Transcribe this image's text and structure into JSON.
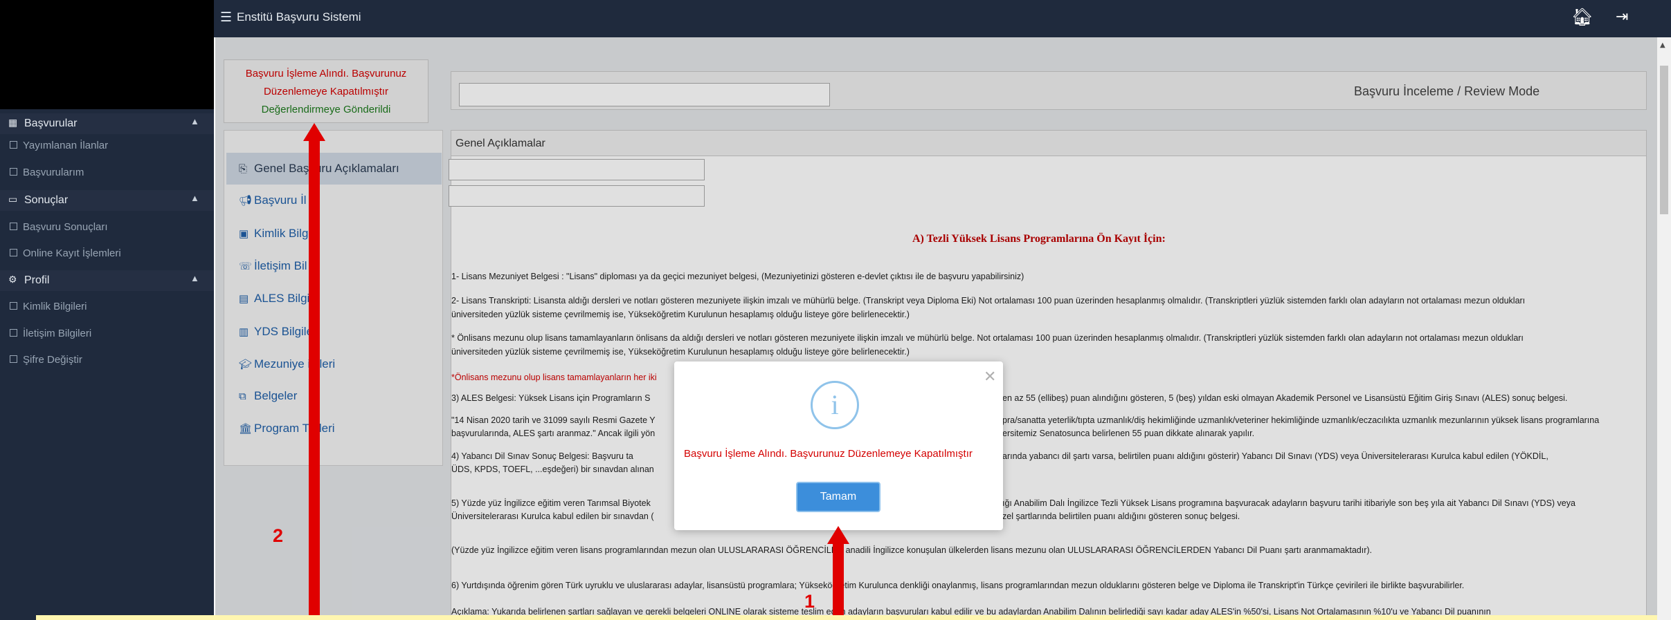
{
  "topbar": {
    "menu_icon": "hamburger-icon",
    "title": "Enstitü Başvuru Sistemi",
    "home_icon": "home-icon",
    "logout_icon": "logout-icon"
  },
  "sidebar": {
    "sections": [
      {
        "label": "Başvurular",
        "icon": "calendar-icon",
        "items": [
          "Yayımlanan İlanlar",
          "Başvurularım"
        ]
      },
      {
        "label": "Sonuçlar",
        "icon": "inbox-icon",
        "items": [
          "Başvuru Sonuçları",
          "Online Kayıt İşlemleri"
        ]
      },
      {
        "label": "Profil",
        "icon": "cogs-icon",
        "items": [
          "Kimlik Bilgileri",
          "İletişim Bilgileri",
          "Şifre Değiştir"
        ]
      }
    ]
  },
  "status": {
    "line1": "Başvuru İşleme Alındı. Başvurunuz",
    "line2": "Düzenlemeye Kapatılmıştır",
    "line3": "Değerlendirmeye Gönderildi"
  },
  "review": {
    "mode_label": "Başvuru İnceleme / Review Mode"
  },
  "left_menu": [
    {
      "label": "Genel Başvuru Açıklamaları",
      "icon": "clipboard-icon"
    },
    {
      "label": "Başvuru İl",
      "icon": "bullhorn-icon"
    },
    {
      "label": "Kimlik Bilgi",
      "icon": "id-card-icon"
    },
    {
      "label": "İletişim Bil",
      "icon": "contacts-icon"
    },
    {
      "label": "ALES Bilgil",
      "icon": "document-icon"
    },
    {
      "label": "YDS Bilgile",
      "icon": "list-icon"
    },
    {
      "label": "Mezuniye       igileri",
      "icon": "graduation-cap-icon"
    },
    {
      "label": "Belgeler",
      "icon": "copy-icon"
    },
    {
      "label": "Program T      hleri",
      "icon": "institution-icon"
    }
  ],
  "panel": {
    "title": "Genel Açıklamalar",
    "heading": "A) Tezli Yüksek Lisans Programlarına Ön Kayıt İçin:",
    "lines": [
      "1- Lisans Mezuniyet Belgesi : \"Lisans\" diploması ya da geçici mezuniyet belgesi, (Mezuniyetinizi gösteren e-devlet çıktısı ile de başvuru yapabilirsiniz)",
      "2- Lisans Transkripti:  Lisansta aldığı dersleri ve notları gösteren mezuniyete ilişkin imzalı ve mühürlü belge. (Transkript veya Diploma Eki) Not ortalaması 100 puan üzerinden hesaplanmış olmalıdır. (Transkriptleri yüzlük sistemden farklı olan adayların not ortalaması mezun oldukları",
      "üniversiteden yüzlük sisteme çevrilmemiş ise, Yükseköğretim Kurulunun hesaplamış olduğu listeye göre belirlenecektir.)",
      "* Önlisans mezunu olup lisans tamamlayanların önlisans da aldığı dersleri ve notları gösteren mezuniyete ilişkin imzalı ve mühürlü belge. Not ortalaması 100 puan üzerinden hesaplanmış olmalıdır. (Transkriptleri yüzlük sistemden farklı olan adayların not ortalaması mezun oldukları",
      "üniversiteden yüzlük sisteme çevrilmemiş ise, Yükseköğretim Kurulunun hesaplamış olduğu listeye göre belirlenecektir.)",
      "*Önlisans mezunu olup lisans tamamlayanların her iki",
      "3)  ALES Belgesi: Yüksek Lisans için Programların S",
      "en az 55 (ellibeş) puan alındığını gösteren, 5 (beş) yıldan eski olmayan Akademik Personel ve Lisansüstü Eğitim Giriş Sınavı (ALES) sonuç belgesi.",
      "\"14 Nisan 2020 tarih ve 31099 sayılı Resmi Gazete Y",
      "pra/sanatta yeterlik/tıpta uzmanlık/diş hekimliğinde uzmanlık/veteriner hekimliğinde uzmanlık/eczacılıkta uzmanlık mezunlarının yüksek lisans programlarına",
      "başvurularında, ALES şartı aranmaz.\" Ancak ilgili yön",
      "ersitemiz Senatosunca belirlenen 55 puan dikkate alınarak yapılır.",
      "4) Yabancı Dil Sınav Sonuç Belgesi: Başvuru ta",
      "arında yabancı dil şartı varsa, belirtilen puanı aldığını gösterir) Yabancı Dil Sınavı (YDS) veya Üniversitelerarası Kurulca kabul edilen (YÖKDİL,",
      "ÜDS, KPDS, TOEFL, ...eşdeğeri)  bir sınavdan alınan",
      "5) Yüzde yüz İngilizce eğitim veren Tarımsal Biyotek",
      "ığı Anabilim Dalı İngilizce Tezli Yüksek Lisans programına başvuracak adayların başvuru tarihi itibariyle son beş yıla ait Yabancı Dil Sınavı (YDS) veya",
      "Üniversitelerarası Kurulca kabul edilen bir sınavdan (",
      "zel şartlarında belirtilen puanı aldığını gösteren sonuç belgesi.",
      "(Yüzde yüz İngilizce eğitim veren lisans programlarından mezun olan ULUSLARARASI ÖĞRENCİLER anadili İngilizce konuşulan ülkelerden lisans mezunu olan ULUSLARARASI ÖĞRENCİLERDEN Yabancı Dil Puanı şartı aranmamaktadır).",
      "6) Yurtdışında öğrenim gören Türk uyruklu ve uluslararası adaylar, lisansüstü programlara; Yükseköğretim Kurulunca denkliği onaylanmış, lisans programlarından mezun olduklarını gösteren belge ve Diploma ile Transkript'in Türkçe çevirileri ile birlikte başvurabilirler.",
      "Açıklama: Yukarıda belirlenen şartları sağlayan ve gerekli belgeleri ONLINE olarak sisteme teslim eden adayların başvuruları kabul edilir ve bu adaylardan Anabilim Dalının belirlediği sayı kadar aday ALES'in %50'si, Lisans Not Ortalamasının %10'u ve Yabancı Dil puanının"
    ]
  },
  "modal": {
    "icon": "info-icon",
    "close_icon": "close-icon",
    "message": "Başvuru İşleme Alındı. Başvurunuz Düzenlemeye Kapatılmıştır",
    "ok_label": "Tamam"
  },
  "annotations": {
    "arrow1_label": "1",
    "arrow2_label": "2",
    "color": "#e00000"
  }
}
